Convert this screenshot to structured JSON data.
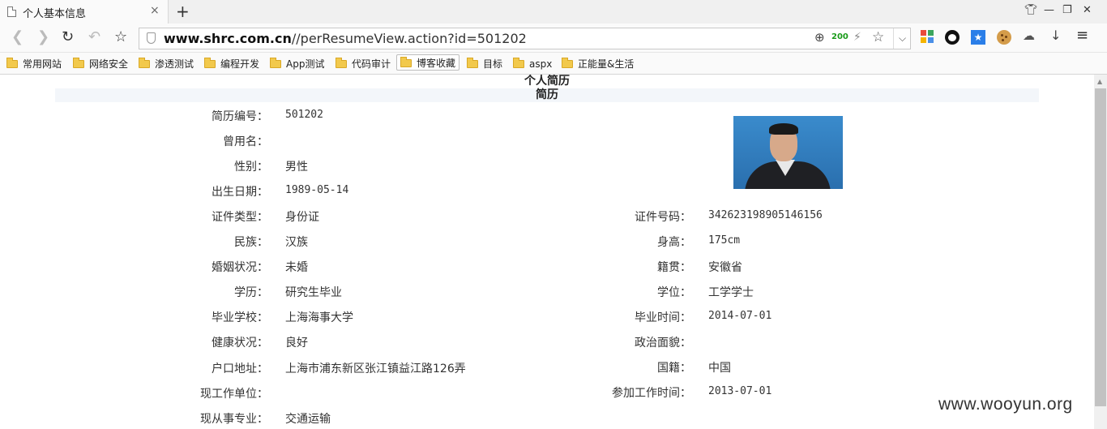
{
  "browser": {
    "tab_title": "个人基本信息",
    "tab_close": "×",
    "new_tab": "+",
    "url_host": "www.shrc.com.cn",
    "url_path": "//perResumeView.action?id=501202",
    "speed_badge": "200",
    "icons": {
      "back": "back-icon",
      "forward": "forward-icon",
      "reload": "reload-icon",
      "undo": "undo-icon",
      "bookmark_star": "star-icon",
      "zoom": "zoom-icon",
      "bolt": "lightning-icon",
      "favorite": "star-icon",
      "menu": "menu-icon",
      "download": "download-icon"
    },
    "bookmarks": [
      "常用网站",
      "网络安全",
      "渗透测试",
      "编程开发",
      "App测试",
      "代码审计",
      "博客收藏",
      "目标",
      "aspx",
      "正能量&生活"
    ]
  },
  "page": {
    "header_title": "个人简历",
    "section_title": "简历",
    "fields_left": [
      {
        "label": "简历编号：",
        "value": "501202",
        "mono": true
      },
      {
        "label": "曾用名：",
        "value": "",
        "mono": false
      },
      {
        "label": "性别：",
        "value": "男性",
        "mono": false
      },
      {
        "label": "出生日期：",
        "value": "1989-05-14",
        "mono": true
      },
      {
        "label": "证件类型：",
        "value": "身份证",
        "mono": false
      },
      {
        "label": "民族：",
        "value": "汉族",
        "mono": false
      },
      {
        "label": "婚姻状况：",
        "value": "未婚",
        "mono": false
      },
      {
        "label": "学历：",
        "value": "研究生毕业",
        "mono": false
      },
      {
        "label": "毕业学校：",
        "value": "上海海事大学",
        "mono": false
      },
      {
        "label": "健康状况：",
        "value": "良好",
        "mono": false
      },
      {
        "label": "户口地址：",
        "value": "上海市浦东新区张江镇益江路126弄",
        "mono": false
      },
      {
        "label": "现工作单位：",
        "value": "",
        "mono": false
      },
      {
        "label": "现从事专业：",
        "value": "交通运输",
        "mono": false
      }
    ],
    "fields_right": [
      {
        "label": "证件号码：",
        "value": "342623198905146156",
        "mono": true
      },
      {
        "label": "身高：",
        "value": "175cm",
        "mono": true
      },
      {
        "label": "籍贯：",
        "value": "安徽省",
        "mono": false
      },
      {
        "label": "学位：",
        "value": "工学学士",
        "mono": false
      },
      {
        "label": "毕业时间：",
        "value": "2014-07-01",
        "mono": true
      },
      {
        "label": "政治面貌：",
        "value": "",
        "mono": false
      },
      {
        "label": "国籍：",
        "value": "中国",
        "mono": false
      },
      {
        "label": "参加工作时间：",
        "value": "2013-07-01",
        "mono": true
      }
    ]
  },
  "watermark": "www.wooyun.org"
}
